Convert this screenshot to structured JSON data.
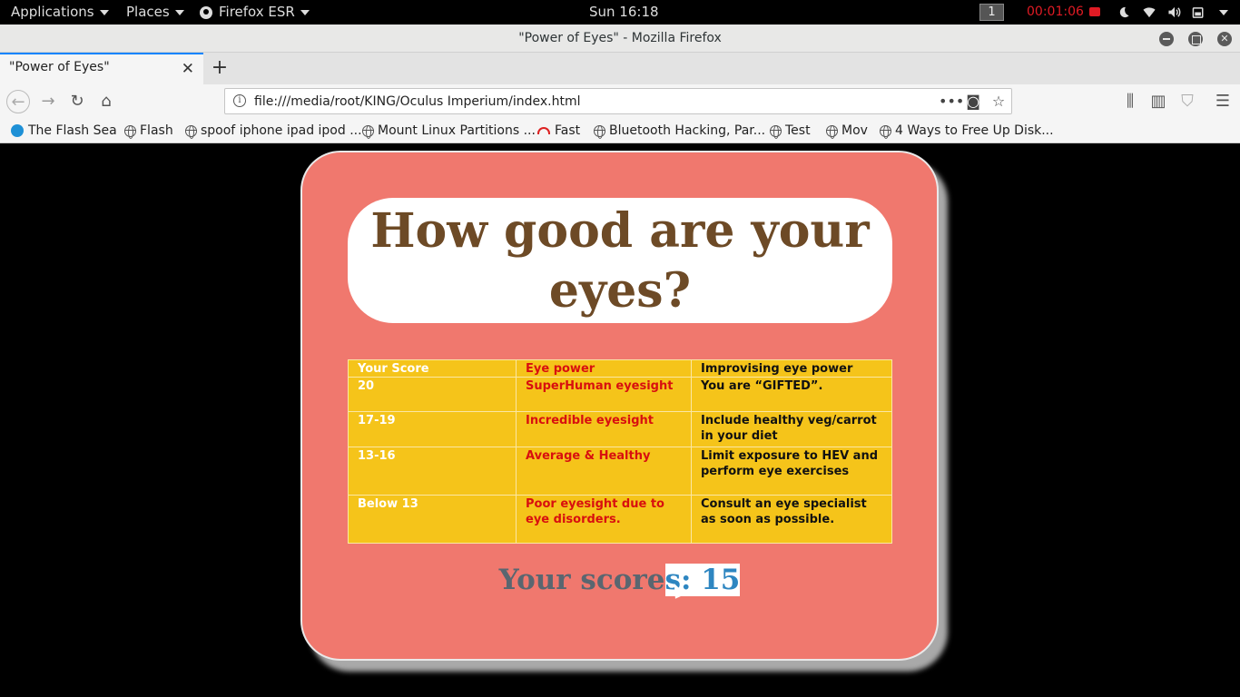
{
  "topbar": {
    "applications": "Applications",
    "places": "Places",
    "browser_menu": "Firefox ESR",
    "clock": "Sun 16:18",
    "workspace": "1",
    "recording_timer": "00:01:06"
  },
  "window": {
    "title": "\"Power of Eyes\" - Mozilla Firefox"
  },
  "tabs": [
    {
      "label": "\"Power of Eyes\""
    }
  ],
  "navbar": {
    "url": "file:///media/root/KING/Oculus Imperium/index.html"
  },
  "bookmarks": [
    {
      "label": "The Flash Sea",
      "icon": "flash-icon"
    },
    {
      "label": "Flash",
      "icon": "globe-icon"
    },
    {
      "label": "spoof iphone ipad ipod ...",
      "icon": "globe-icon"
    },
    {
      "label": "Mount Linux Partitions ...",
      "icon": "globe-icon"
    },
    {
      "label": "Fast",
      "icon": "speedometer-icon"
    },
    {
      "label": "Bluetooth Hacking, Par...",
      "icon": "globe-icon"
    },
    {
      "label": "Test",
      "icon": "globe-icon"
    },
    {
      "label": "Mov",
      "icon": "globe-icon"
    },
    {
      "label": "4 Ways to Free Up Disk...",
      "icon": "globe-icon"
    }
  ],
  "page": {
    "heading": "How good are your eyes?",
    "table": {
      "headers": [
        "Your Score",
        "Eye power",
        "Improvising eye power"
      ],
      "rows": [
        [
          "20",
          "SuperHuman eyesight",
          "You are “GIFTED”."
        ],
        [
          "17-19",
          "Incredible eyesight",
          "Include healthy veg/carrot in your diet"
        ],
        [
          "13-16",
          "Average & Healthy",
          "Limit exposure to HEV and perform eye exercises"
        ],
        [
          "Below 13",
          "Poor eyesight due to eye disorders.",
          "Consult an eye specialist as soon as possible."
        ]
      ]
    },
    "score_label": "Your score",
    "score_value": "s: 15"
  },
  "colors": {
    "card": "#f0786e",
    "heading_text": "#6d4a26",
    "table_bg": "#f5c41a",
    "eye_power_text": "#d80f0f",
    "score_value": "#2e86c1",
    "tab_accent": "#0a84ff",
    "recording": "#e01b24"
  }
}
